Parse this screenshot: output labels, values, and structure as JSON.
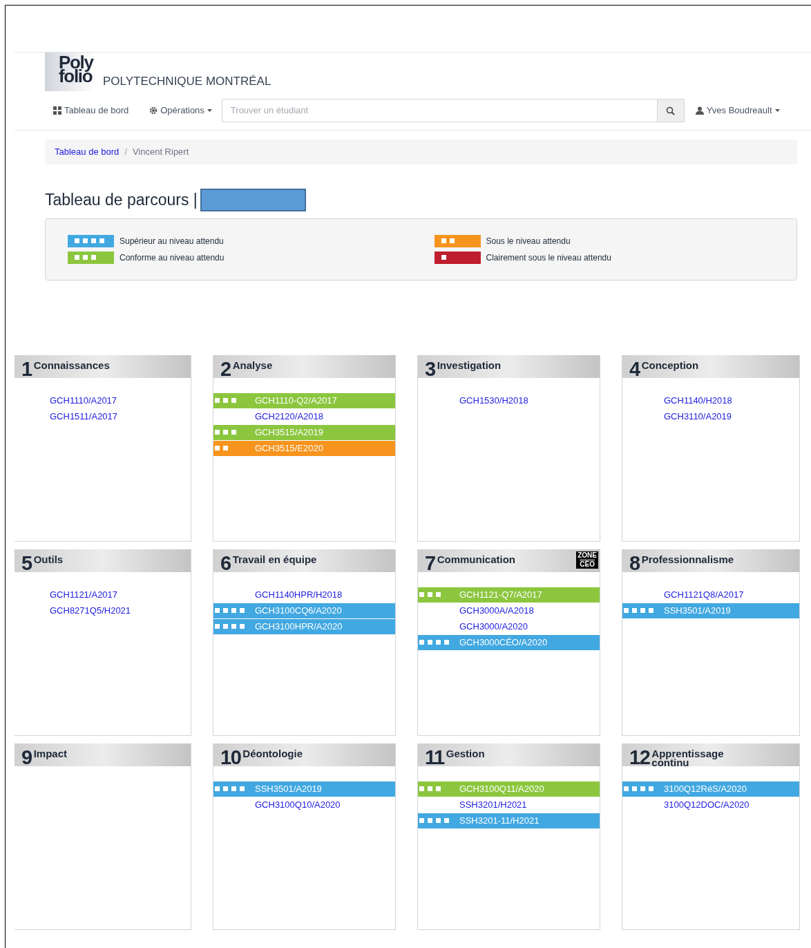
{
  "header": {
    "logo_top": "Poly",
    "logo_bottom": "folio",
    "school": "POLYTECHNIQUE MONTRÉAL"
  },
  "nav": {
    "items": [
      {
        "kind": "grid",
        "label": "Tableau de bord",
        "dropdown": false
      },
      {
        "kind": "gear",
        "label": "Opérations",
        "dropdown": true
      }
    ],
    "search": {
      "placeholder": "Trouver un étudiant"
    },
    "user": "Yves Boudreault"
  },
  "breadcrumb": {
    "separator": "/",
    "items": [
      {
        "label": "Tableau de bord",
        "link": true
      },
      {
        "label": "Vincent Ripert",
        "link": false
      }
    ]
  },
  "page_title": "Tableau de parcours |",
  "legend": [
    {
      "kind": "superieur",
      "label": "Supérieur au niveau attendu"
    },
    {
      "kind": "sous",
      "label": "Sous le niveau attendu"
    },
    {
      "kind": "conforme",
      "label": "Conforme au niveau attendu"
    },
    {
      "kind": "clairement_sous",
      "label": "Clairement sous le niveau attendu"
    }
  ],
  "cards": [
    {
      "number": "1",
      "title": "Connaissances",
      "courses": [
        {
          "code": "GCH1110/A2017",
          "kind": "none"
        },
        {
          "code": "GCH1511/A2017",
          "kind": "none"
        }
      ]
    },
    {
      "number": "2",
      "title": "Analyse",
      "courses": [
        {
          "code": "GCH1110-Q2/A2017",
          "kind": "conforme"
        },
        {
          "code": "GCH2120/A2018",
          "kind": "none"
        },
        {
          "code": "GCH3515/A2019",
          "kind": "conforme"
        },
        {
          "code": "GCH3515/E2020",
          "kind": "sous"
        }
      ]
    },
    {
      "number": "3",
      "title": "Investigation",
      "courses": [
        {
          "code": "GCH1530/H2018",
          "kind": "none"
        }
      ]
    },
    {
      "number": "4",
      "title": "Conception",
      "courses": [
        {
          "code": "GCH1140/H2018",
          "kind": "none"
        },
        {
          "code": "GCH3110/A2019",
          "kind": "none"
        }
      ]
    },
    {
      "number": "5",
      "title": "Outils",
      "courses": [
        {
          "code": "GCH1121/A2017",
          "kind": "none"
        },
        {
          "code": "GCH8271Q5/H2021",
          "kind": "none"
        }
      ]
    },
    {
      "number": "6",
      "title": "Travail en équipe",
      "courses": [
        {
          "code": "GCH1140HPR/H2018",
          "kind": "none"
        },
        {
          "code": "GCH3100CQ6/A2020",
          "kind": "superieur"
        },
        {
          "code": "GCH3100HPR/A2020",
          "kind": "superieur"
        }
      ]
    },
    {
      "number": "7",
      "title": "Communication",
      "badge": [
        "ZONE",
        "CÉO"
      ],
      "courses": [
        {
          "code": "GCH1121-Q7/A2017",
          "kind": "conforme"
        },
        {
          "code": "GCH3000A/A2018",
          "kind": "none"
        },
        {
          "code": "GCH3000/A2020",
          "kind": "none"
        },
        {
          "code": "GCH3000CÉO/A2020",
          "kind": "superieur"
        }
      ]
    },
    {
      "number": "8",
      "title": "Professionnalisme",
      "courses": [
        {
          "code": "GCH1121Q8/A2017",
          "kind": "none"
        },
        {
          "code": "SSH3501/A2019",
          "kind": "superieur"
        }
      ]
    },
    {
      "number": "9",
      "title": "Impact"
    },
    {
      "number": "10",
      "title": "Déontologie",
      "courses": [
        {
          "code": "SSH3501/A2019",
          "kind": "superieur"
        },
        {
          "code": "GCH3100Q10/A2020",
          "kind": "none"
        }
      ]
    },
    {
      "number": "11",
      "title": "Gestion",
      "courses": [
        {
          "code": "GCH3100Q11/A2020",
          "kind": "conforme"
        },
        {
          "code": "SSH3201/H2021",
          "kind": "none"
        },
        {
          "code": "SSH3201-11/H2021",
          "kind": "superieur"
        }
      ]
    },
    {
      "number": "12",
      "title": "Apprentissage continu",
      "courses": [
        {
          "code": "3100Q12RéS/A2020",
          "kind": "superieur"
        },
        {
          "code": "3100Q12DOC/A2020",
          "kind": "none"
        }
      ]
    }
  ]
}
